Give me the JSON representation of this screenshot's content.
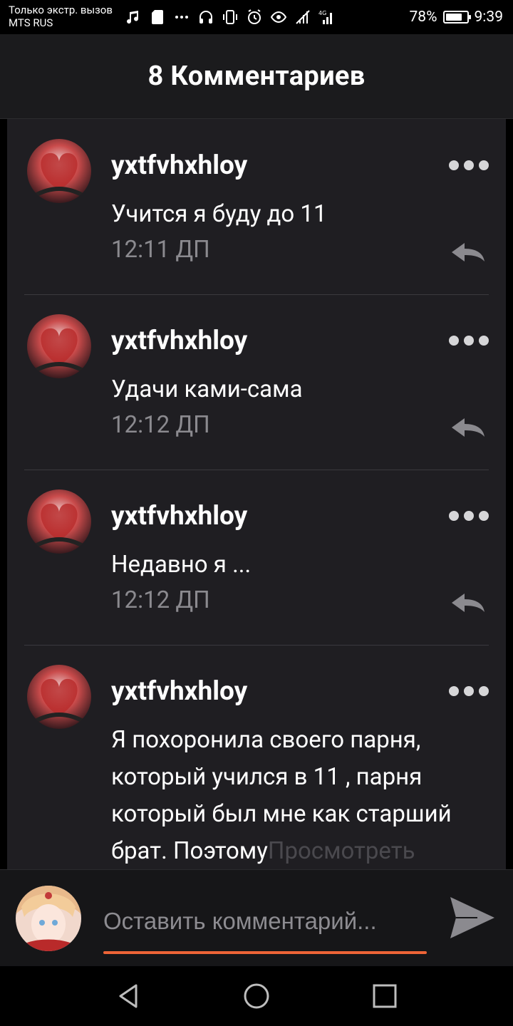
{
  "status_bar": {
    "carrier_line1": "Только экстр. вызов",
    "carrier_line2": "MTS RUS",
    "battery_pct": "78%",
    "battery_level": 0.78,
    "time": "9:39",
    "icons": [
      "music-icon",
      "sd-card-icon",
      "more-notifications-icon",
      "headset-icon",
      "vibrate-icon",
      "alarm-icon",
      "eye-comfort-icon",
      "no-signal-icon",
      "signal-4g-icon"
    ]
  },
  "header": {
    "title": "8 Комментариев"
  },
  "comments": [
    {
      "username": "yxtfvhxhloy",
      "text": "Учится я буду до 11",
      "time": "12:11 ДП"
    },
    {
      "username": "yxtfvhxhloy",
      "text": "Удачи ками-сама",
      "time": "12:12 ДП"
    },
    {
      "username": "yxtfvhxhloy",
      "text": "Недавно я ...",
      "time": "12:12 ДП"
    },
    {
      "username": "yxtfvhxhloy",
      "text": "Я похоронила своего парня, который учился в 11 , парня который был мне как старший брат. Поэтому",
      "more_link": "Просмотреть",
      "time": ""
    }
  ],
  "composer": {
    "placeholder": "Оставить комментарий...",
    "value": ""
  },
  "colors": {
    "accent": "#ee6437",
    "panel": "#1f1e22",
    "header": "#1b1b1d"
  }
}
